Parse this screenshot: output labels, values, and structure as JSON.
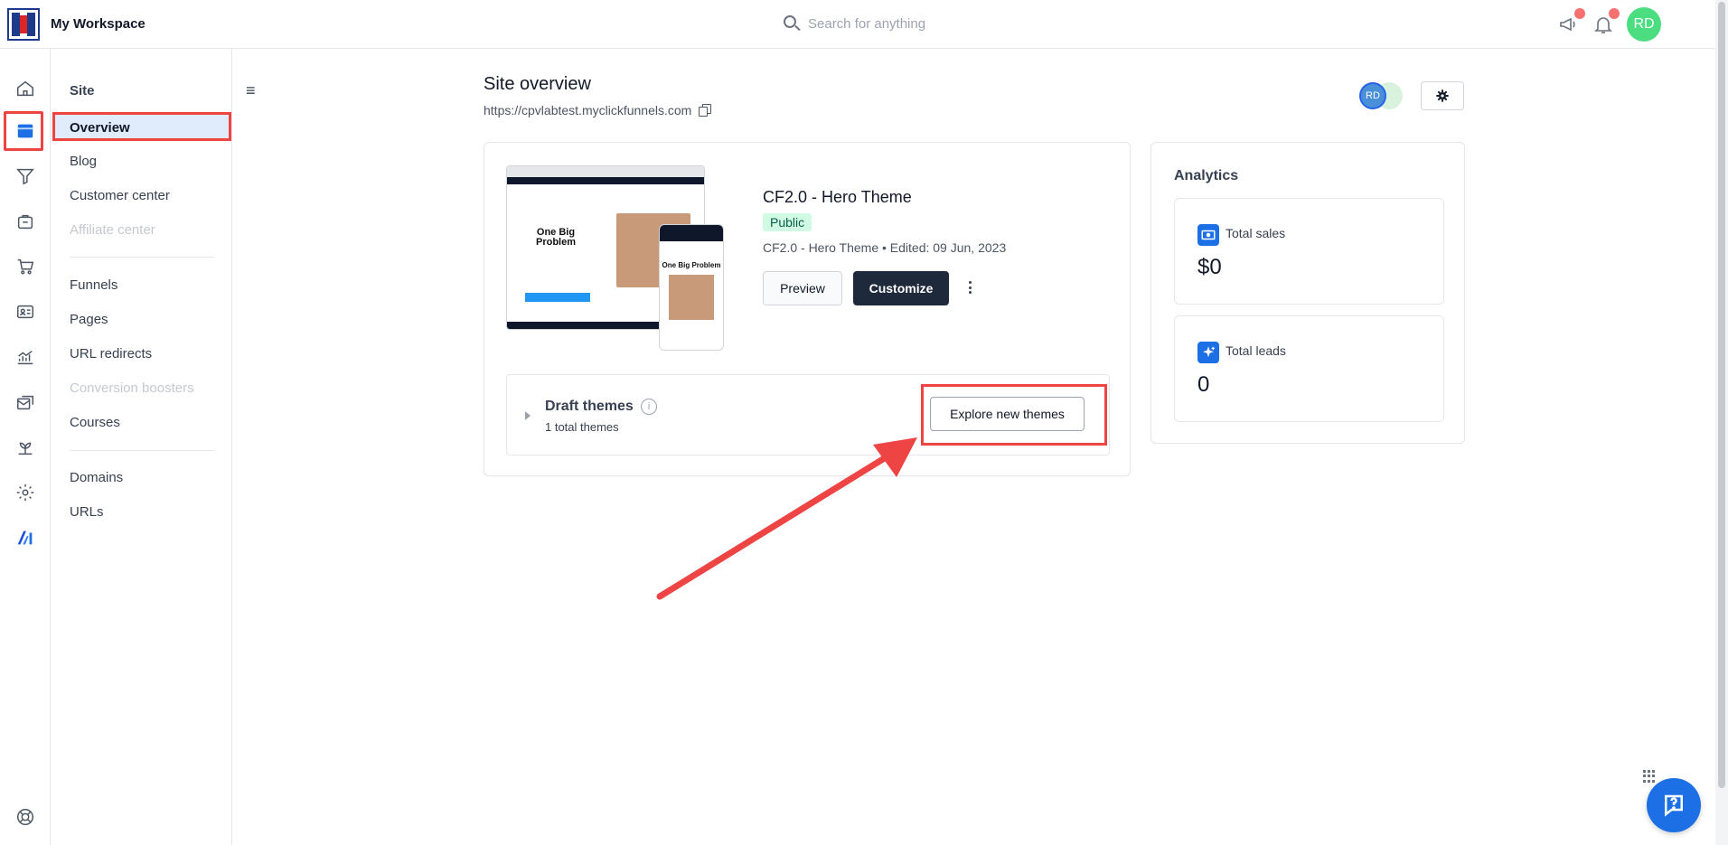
{
  "topbar": {
    "workspace": "My Workspace",
    "search_placeholder": "Search for anything",
    "avatar_initials": "RD"
  },
  "rail": {
    "items": [
      "home-icon",
      "sites-icon",
      "funnel-icon",
      "store-icon",
      "cart-icon",
      "contacts-icon",
      "analytics-icon",
      "email-icon",
      "courses-icon",
      "settings-icon",
      "ai-icon"
    ],
    "active": "sites-icon"
  },
  "sidebar": {
    "heading": "Site",
    "items": [
      {
        "label": "Overview",
        "active": true
      },
      {
        "label": "Blog"
      },
      {
        "label": "Customer center"
      },
      {
        "label": "Affiliate center",
        "disabled": true
      }
    ],
    "items2": [
      {
        "label": "Funnels"
      },
      {
        "label": "Pages"
      },
      {
        "label": "URL redirects"
      },
      {
        "label": "Conversion boosters",
        "disabled": true
      },
      {
        "label": "Courses"
      }
    ],
    "items3": [
      {
        "label": "Domains"
      },
      {
        "label": "URLs"
      }
    ]
  },
  "main": {
    "title": "Site overview",
    "url": "https://cpvlabtest.myclickfunnels.com",
    "collaborator_initials": "RD",
    "theme": {
      "name": "CF2.0 - Hero Theme",
      "status": "Public",
      "meta": "CF2.0 - Hero Theme • Edited: 09 Jun, 2023",
      "preview_label": "Preview",
      "customize_label": "Customize",
      "thumb_heading": "One Big Problem"
    },
    "drafts": {
      "title": "Draft themes",
      "subtitle": "1 total themes",
      "explore_label": "Explore new themes"
    }
  },
  "analytics": {
    "title": "Analytics",
    "stats": [
      {
        "label": "Total sales",
        "value": "$0"
      },
      {
        "label": "Total leads",
        "value": "0"
      }
    ]
  },
  "colors": {
    "accent": "#1d6fe5",
    "highlight": "#ef4444",
    "dark_button": "#1e293b",
    "badge_bg": "#d1fae5"
  }
}
